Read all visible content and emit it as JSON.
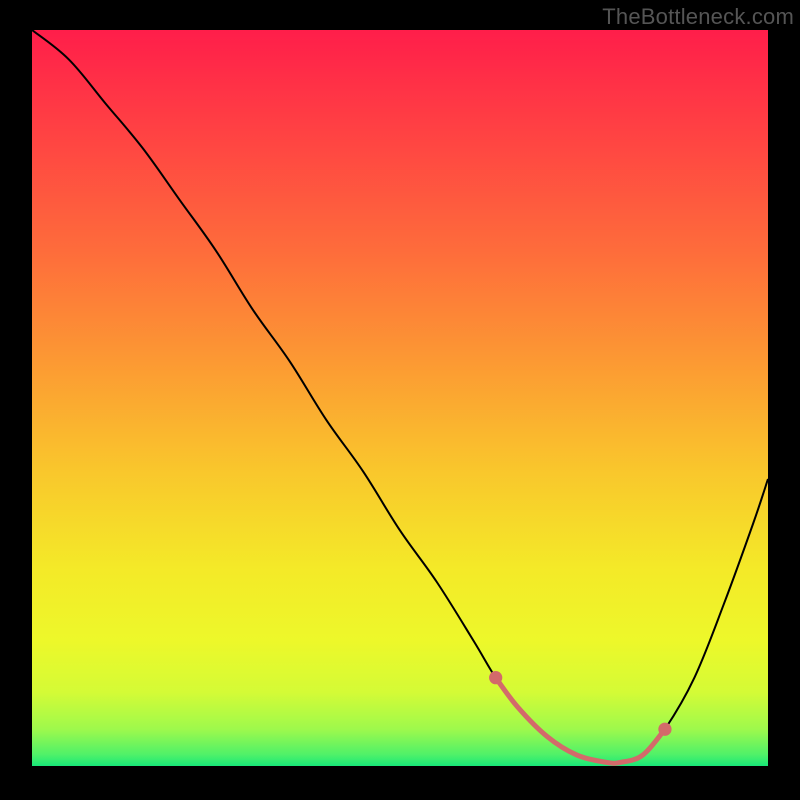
{
  "watermark": "TheBottleneck.com",
  "colors": {
    "frame": "#000000",
    "watermark": "#555555",
    "curve_stroke": "#000000",
    "highlight_stroke": "#D36A6A",
    "gradient_stops": [
      {
        "offset": 0.0,
        "color": "#FF1E4A"
      },
      {
        "offset": 0.14,
        "color": "#FF4243"
      },
      {
        "offset": 0.3,
        "color": "#FE6C3B"
      },
      {
        "offset": 0.45,
        "color": "#FC9933"
      },
      {
        "offset": 0.6,
        "color": "#F9C72C"
      },
      {
        "offset": 0.73,
        "color": "#F4E928"
      },
      {
        "offset": 0.83,
        "color": "#EDF82A"
      },
      {
        "offset": 0.9,
        "color": "#D4FB36"
      },
      {
        "offset": 0.95,
        "color": "#9EF94C"
      },
      {
        "offset": 0.985,
        "color": "#4EF169"
      },
      {
        "offset": 1.0,
        "color": "#18E778"
      }
    ]
  },
  "chart_data": {
    "type": "line",
    "title": "",
    "xlabel": "",
    "ylabel": "",
    "xlim": [
      0,
      100
    ],
    "ylim": [
      0,
      100
    ],
    "grid": false,
    "legend": false,
    "series": [
      {
        "name": "bottleneck-curve",
        "x": [
          0,
          5,
          10,
          15,
          20,
          25,
          30,
          35,
          40,
          45,
          50,
          55,
          60,
          63,
          66,
          70,
          74,
          78,
          80,
          83,
          86,
          90,
          94,
          98,
          100
        ],
        "values": [
          100,
          96,
          90,
          84,
          77,
          70,
          62,
          55,
          47,
          40,
          32,
          25,
          17,
          12,
          8,
          4,
          1.5,
          0.5,
          0.5,
          1.5,
          5,
          12,
          22,
          33,
          39
        ]
      },
      {
        "name": "optimal-highlight",
        "x": [
          63,
          66,
          70,
          74,
          78,
          80,
          83,
          86
        ],
        "values": [
          12,
          8,
          4,
          1.5,
          0.5,
          0.5,
          1.5,
          5
        ]
      }
    ],
    "background_gradient_axis": "y"
  }
}
